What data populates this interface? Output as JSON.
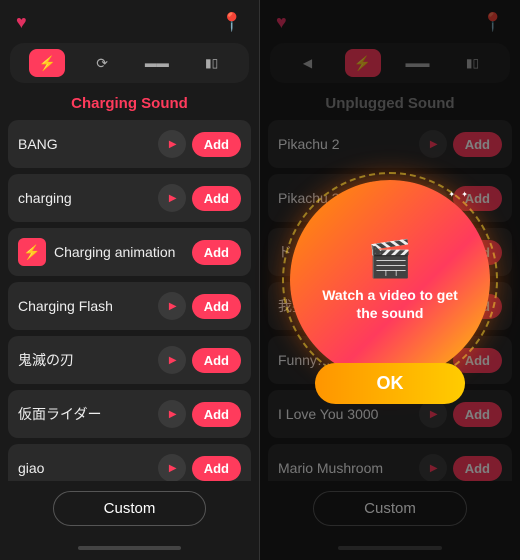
{
  "left": {
    "section_title": "Charging Sound",
    "items": [
      {
        "id": "bang",
        "name": "BANG",
        "has_icon": false
      },
      {
        "id": "charging",
        "name": "charging",
        "has_icon": false
      },
      {
        "id": "charging_animation",
        "name": "Charging animation",
        "has_icon": true
      },
      {
        "id": "charging_flash",
        "name": "Charging Flash",
        "has_icon": false
      },
      {
        "id": "kimetsu",
        "name": "鬼滅の刃",
        "has_icon": false
      },
      {
        "id": "kamen_rider",
        "name": "仮面ライダー",
        "has_icon": false
      },
      {
        "id": "giao",
        "name": "giao",
        "has_icon": false
      }
    ],
    "add_label": "Add",
    "custom_label": "Custom"
  },
  "right": {
    "section_title": "Unplugged Sound",
    "items": [
      {
        "id": "pikachu2",
        "name": "Pikachu 2"
      },
      {
        "id": "pikachu3",
        "name": "Pikachu 3"
      },
      {
        "id": "japanese1",
        "name": "ドゥドゥル"
      },
      {
        "id": "chinese1",
        "name": "我要回…"
      },
      {
        "id": "funny",
        "name": "Funny…"
      },
      {
        "id": "iloveyou",
        "name": "I Love You 3000"
      },
      {
        "id": "mario",
        "name": "Mario Mushroom"
      }
    ],
    "add_label": "Add",
    "custom_label": "Custom"
  },
  "popup": {
    "text": "Watch a video to get the sound",
    "ok_label": "OK"
  },
  "icons": {
    "heart": "♥",
    "location": "📍",
    "play": "▶",
    "video": "🎬"
  }
}
